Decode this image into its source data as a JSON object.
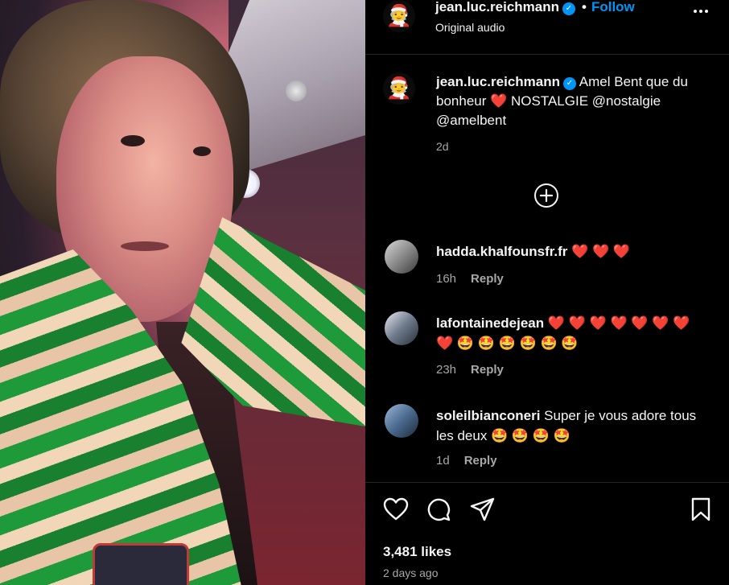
{
  "post": {
    "username": "jean.luc.reichmann",
    "follow_label": "Follow",
    "separator": "•",
    "audio": "Original audio",
    "avatar_emoji": "🧑‍🎄",
    "caption_text": " Amel Bent que du bonheur ❤️ NOSTALGIE @nostalgie @amelbent",
    "caption_time": "2d"
  },
  "comments": [
    {
      "username": "hadda.khalfounsfr.fr",
      "text": " ❤️ ❤️ ❤️",
      "time": "16h",
      "reply": "Reply"
    },
    {
      "username": "lafontainedejean",
      "text": " ❤️ ❤️ ❤️ ❤️ ❤️ ❤️ ❤️ ❤️ 🤩 🤩 🤩 🤩 🤩 🤩",
      "time": "23h",
      "reply": "Reply"
    },
    {
      "username": "soleilbianconeri",
      "text": " Super je vous adore tous les deux 🤩 🤩 🤩 🤩",
      "time": "1d",
      "reply": "Reply"
    }
  ],
  "footer": {
    "likes": "3,481 likes",
    "ago": "2 days ago"
  },
  "colors": {
    "background": "#000000",
    "accent": "#0095f6",
    "muted_text": "#a8a8a8"
  }
}
